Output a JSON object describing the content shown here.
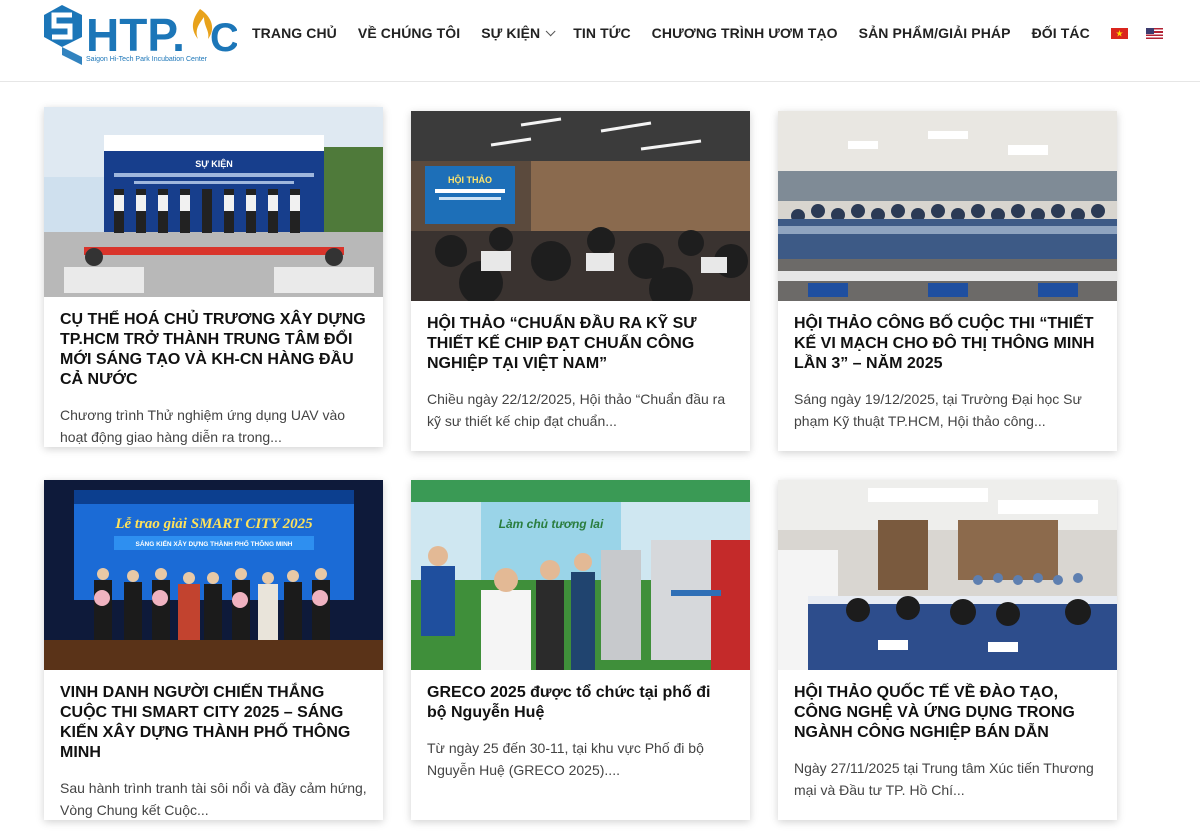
{
  "logo": {
    "wordmark": "SHTP.IC",
    "tagline": "Saigon Hi-Tech Park Incubation Center"
  },
  "nav": {
    "items": [
      {
        "label": "TRANG CHỦ"
      },
      {
        "label": "VỀ CHÚNG TÔI"
      },
      {
        "label": "SỰ KIỆN"
      },
      {
        "label": "TIN TỨC"
      },
      {
        "label": "CHƯƠNG TRÌNH ƯƠM TẠO"
      },
      {
        "label": "SẢN PHẨM/GIẢI PHÁP"
      },
      {
        "label": "ĐỐI TÁC"
      }
    ],
    "flags": [
      "vietnam-flag-icon",
      "us-flag-icon"
    ]
  },
  "posts": [
    {
      "title": "CỤ THỂ HOÁ CHỦ TRƯƠNG XÂY DỰNG TP.HCM TRỞ THÀNH TRUNG TÂM ĐỔI MỚI SÁNG TẠO VÀ KH-CN HÀNG ĐẦU CẢ NƯỚC",
      "excerpt": "Chương trình Thử nghiệm ứng dụng UAV vào hoạt động giao hàng diễn ra trong..."
    },
    {
      "title": "HỘI THẢO “CHUẨN ĐẦU RA KỸ SƯ THIẾT KẾ CHIP ĐẠT CHUẨN CÔNG NGHIỆP TẠI VIỆT NAM”",
      "excerpt": "Chiều ngày 22/12/2025, Hội thảo “Chuẩn đầu ra kỹ sư thiết kế chip đạt chuẩn..."
    },
    {
      "title": "HỘI THẢO CÔNG BỐ CUỘC THI “THIẾT KẾ VI MẠCH CHO ĐÔ THỊ THÔNG MINH LẦN 3” – NĂM 2025",
      "excerpt": "Sáng ngày 19/12/2025, tại Trường Đại học Sư phạm Kỹ thuật TP.HCM, Hội thảo công..."
    },
    {
      "title": "VINH DANH NGƯỜI CHIẾN THẮNG CUỘC THI SMART CITY 2025 – SÁNG KIẾN XÂY DỰNG THÀNH PHỐ THÔNG MINH",
      "excerpt": "Sau hành trình tranh tài sôi nổi và đầy cảm hứng, Vòng Chung kết Cuộc..."
    },
    {
      "title": "GRECO 2025 được tổ chức tại phố đi bộ Nguyễn Huệ",
      "excerpt": "Từ ngày 25 đến 30-11, tại khu vực Phố đi bộ Nguyễn Huệ (GRECO 2025)...."
    },
    {
      "title": "HỘI THẢO QUỐC TẾ VỀ ĐÀO TẠO, CÔNG NGHỆ VÀ ỨNG DỤNG TRONG NGÀNH CÔNG NGHIỆP BÁN DẪN",
      "excerpt": "Ngày 27/11/2025 tại Trung tâm Xúc tiến Thương mại và Đầu tư TP. Hồ Chí..."
    }
  ],
  "photo_texts": {
    "p1_banner": "SỰ KIỆN",
    "p2_screen": "HỘI THẢO",
    "p4_screen": "Lễ trao giải SMART CITY 2025",
    "p4_sub": "SÁNG KIẾN XÂY DỰNG THÀNH PHỐ THÔNG MINH",
    "p5_sign": "Làm chủ tương lai"
  },
  "colors": {
    "brand_blue": "#1c76b8",
    "brand_gold": "#e8a21b"
  }
}
